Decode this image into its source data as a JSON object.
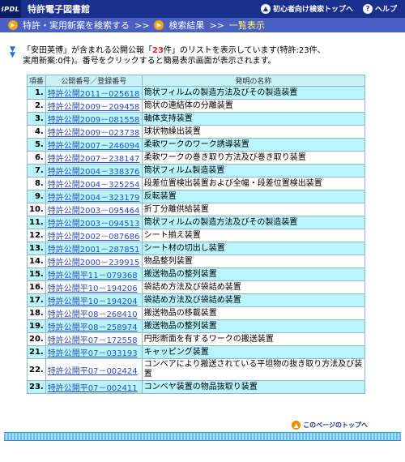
{
  "header": {
    "logo": "IPDL",
    "app_title": "特許電子図書館",
    "beginner_link": "初心者向け検索トップへ",
    "help_link": "ヘルプ",
    "breadcrumb": [
      "特許・実用新案を検索する",
      "検索結果",
      "一覧表示"
    ],
    "separator": ">>"
  },
  "intro": {
    "prefix": "「",
    "name": "安田英博",
    "mid1": "」が含まれる公開公報「",
    "count": "23",
    "mid2": "件」のリストを表示しています(特許:23件、",
    "line2": "実用新案:0件)。番号をクリックすると簡易表示画面が表示されます。"
  },
  "table": {
    "headers": [
      "項番",
      "公開番号／登録番号",
      "発明の名称"
    ],
    "rows": [
      {
        "no": "1.",
        "number": "特許公開2011－025618",
        "title": "筒状フィルムの製造方法及びその製造装置"
      },
      {
        "no": "2.",
        "number": "特許公開2009－209458",
        "title": "筒状の連結体の分離装置"
      },
      {
        "no": "3.",
        "number": "特許公開2009－081558",
        "title": "軸体支持装置"
      },
      {
        "no": "4.",
        "number": "特許公開2009－023738",
        "title": "球状物繰出装置"
      },
      {
        "no": "5.",
        "number": "特許公開2007－246094",
        "title": "柔軟ワークのワーク誘導装置"
      },
      {
        "no": "6.",
        "number": "特許公開2007－238147",
        "title": "柔軟ワークの巻き取り方法及び巻き取り装置"
      },
      {
        "no": "7.",
        "number": "特許公開2004－338376",
        "title": "筒状フィルム製造装置"
      },
      {
        "no": "8.",
        "number": "特許公開2004－325254",
        "title": "段差位置検出装置および全幅・段差位置検出装置"
      },
      {
        "no": "9.",
        "number": "特許公開2004－323179",
        "title": "反転装置"
      },
      {
        "no": "10.",
        "number": "特許公開2003－095464",
        "title": "折丁分離供給装置"
      },
      {
        "no": "11.",
        "number": "特許公開2003－094513",
        "title": "筒状フィルムの製造方法及びその製造装置"
      },
      {
        "no": "12.",
        "number": "特許公開2002－087686",
        "title": "シート揃え装置"
      },
      {
        "no": "13.",
        "number": "特許公開2001－287851",
        "title": "シート材の切出し装置"
      },
      {
        "no": "14.",
        "number": "特許公開2000－239915",
        "title": "物品整列装置"
      },
      {
        "no": "15.",
        "number": "特許公開平11－079368",
        "title": "搬送物品の整列装置"
      },
      {
        "no": "16.",
        "number": "特許公開平10－194206",
        "title": "袋詰め方法及び袋詰め装置"
      },
      {
        "no": "17.",
        "number": "特許公開平10－194204",
        "title": "袋詰め方法及び袋詰め装置"
      },
      {
        "no": "18.",
        "number": "特許公開平08－268410",
        "title": "搬送物品の移載装置"
      },
      {
        "no": "19.",
        "number": "特許公開平08－258974",
        "title": "搬送物品の整列装置"
      },
      {
        "no": "20.",
        "number": "特許公開平07－172558",
        "title": "円形断面を有するワークの搬送装置"
      },
      {
        "no": "21.",
        "number": "特許公開平07－033193",
        "title": "キャッピング装置"
      },
      {
        "no": "22.",
        "number": "特許公開平07－002424",
        "title": "コンベアにより搬送されている平坦物の抜き取り方法及び装置"
      },
      {
        "no": "23.",
        "number": "特許公開平07－002411",
        "title": "コンベヤ装置の物品抜取り装置"
      }
    ]
  },
  "footer": {
    "page_top_link": "このページのトップへ"
  },
  "colors": {
    "header_bg": "#1b2f8c",
    "breadcrumb_bg": "#4a5fc0",
    "row_highlight": "#b9f4fb",
    "link": "#2b4fc5",
    "count_highlight": "#e0272a"
  }
}
